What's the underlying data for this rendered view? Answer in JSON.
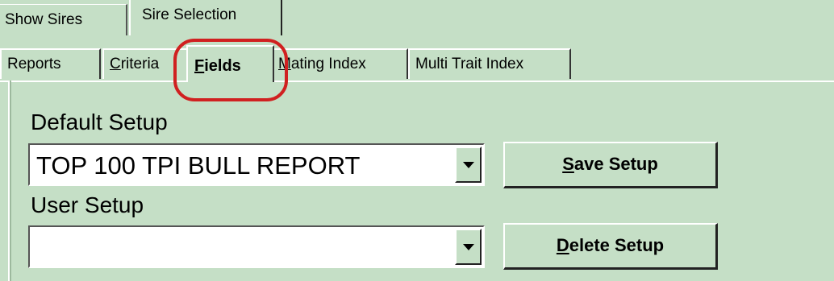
{
  "top_tabs": [
    {
      "label": "Show Sires"
    },
    {
      "label": "Sire Selection"
    }
  ],
  "sub_tabs": [
    {
      "label": "Reports"
    },
    {
      "label_hot": "C",
      "label_rest": "riteria"
    },
    {
      "label_hot": "F",
      "label_rest": "ields"
    },
    {
      "label_hot": "M",
      "label_rest": "ating Index"
    },
    {
      "label": "Multi Trait Index"
    }
  ],
  "default_setup": {
    "label": "Default Setup",
    "value": "TOP 100 TPI BULL REPORT"
  },
  "user_setup": {
    "label": "User Setup",
    "value": ""
  },
  "buttons": {
    "save_hot": "S",
    "save_rest": "ave Setup",
    "delete_hot": "D",
    "delete_rest": "elete Setup"
  },
  "colors": {
    "panel": "#c5dfc6",
    "highlight": "#d02020"
  },
  "icons": [
    "dropdown-arrow-icon"
  ]
}
